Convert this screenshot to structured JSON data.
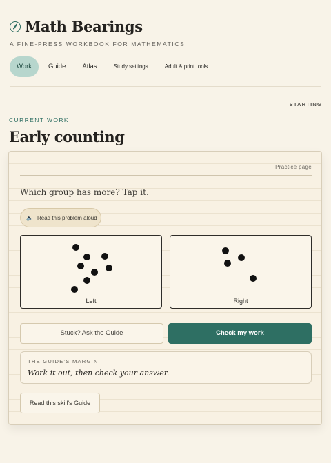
{
  "app": {
    "title": "Math Bearings",
    "tagline": "A FINE-PRESS WORKBOOK FOR MATHEMATICS"
  },
  "nav": {
    "tabs": [
      {
        "label": "Work",
        "active": true
      },
      {
        "label": "Guide",
        "active": false
      },
      {
        "label": "Atlas",
        "active": false
      },
      {
        "label": "Study settings",
        "active": false
      },
      {
        "label": "Adult & print tools",
        "active": false
      }
    ]
  },
  "status": "STARTING",
  "main": {
    "kicker": "CURRENT WORK",
    "heading": "Early counting",
    "page_label": "Practice page",
    "question": "Which group has more? Tap it.",
    "read_aloud": "Read this problem aloud",
    "groups": {
      "left": {
        "label": "Left",
        "dot_count": 8
      },
      "right": {
        "label": "Right",
        "dot_count": 4
      }
    },
    "stuck_button": "Stuck? Ask the Guide",
    "check_button": "Check my work",
    "margin": {
      "kicker": "THE GUIDE'S MARGIN",
      "text": "Work it out, then check your answer."
    },
    "guide_button": "Read this skill's Guide"
  },
  "colors": {
    "accent": "#2e6f63",
    "active_tab": "#b7d6cd",
    "background": "#f8f3e8"
  },
  "icons": {
    "brand": "compass-icon",
    "read_aloud": "speaker-icon"
  }
}
